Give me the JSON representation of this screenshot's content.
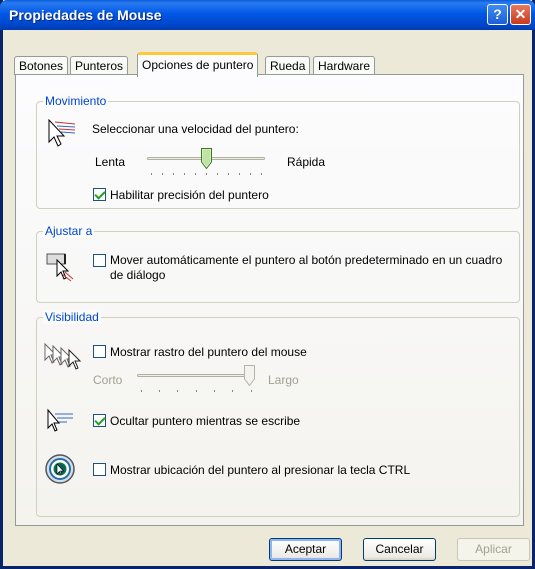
{
  "window": {
    "title": "Propiedades de Mouse",
    "help_glyph": "?",
    "close_glyph": "✕"
  },
  "tabs": [
    {
      "label": "Botones"
    },
    {
      "label": "Punteros"
    },
    {
      "label": "Opciones de puntero",
      "active": true
    },
    {
      "label": "Rueda"
    },
    {
      "label": "Hardware"
    }
  ],
  "movimiento": {
    "legend": "Movimiento",
    "prompt": "Seleccionar una velocidad del puntero:",
    "slow_label": "Lenta",
    "fast_label": "Rápida",
    "speed_level": 0.5,
    "precision_label": "Habilitar precisión del puntero",
    "precision_checked": true
  },
  "ajustar": {
    "legend": "Ajustar a",
    "snap_label_line1": "Mover automáticamente el puntero al botón predeterminado en un cuadro",
    "snap_label_line2": "de diálogo",
    "snap_checked": false
  },
  "visibilidad": {
    "legend": "Visibilidad",
    "trails_label": "Mostrar rastro del puntero del mouse",
    "trails_checked": false,
    "short_label": "Corto",
    "long_label": "Largo",
    "trail_level": 1.0,
    "hide_label": "Ocultar puntero mientras se escribe",
    "hide_checked": true,
    "ctrl_label": "Mostrar ubicación del puntero al presionar la tecla CTRL",
    "ctrl_checked": false
  },
  "buttons": {
    "ok": "Aceptar",
    "cancel": "Cancelar",
    "apply": "Aplicar"
  },
  "colors": {
    "titlebar": "#0058e6",
    "legend": "#0046d5",
    "tab_highlight": "#ffc83c",
    "face": "#ece9d8"
  }
}
